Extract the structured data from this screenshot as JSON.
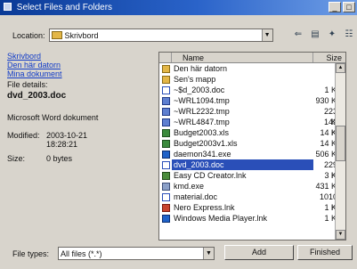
{
  "window": {
    "title": "Select Files and Folders"
  },
  "location": {
    "label": "Location:",
    "value": "Skrivbord"
  },
  "left": {
    "links": [
      "Skrivbord",
      "Den här datorn",
      "Mina dokument"
    ],
    "details_heading": "File details:",
    "file_name": "dvd_2003.doc",
    "file_type": "Microsoft Word dokument",
    "modified_label": "Modified:",
    "modified_value_line1": "2003-10-21",
    "modified_value_line2": "18:28:21",
    "size_label": "Size:",
    "size_value": "0 bytes"
  },
  "list": {
    "col_name": "Name",
    "col_size": "Size",
    "rows": [
      {
        "name": "Den här datorn",
        "size": "",
        "icon": "folder"
      },
      {
        "name": "Sen's mapp",
        "size": "",
        "icon": "folder"
      },
      {
        "name": "~$d_2003.doc",
        "size": "1 KB",
        "icon": "doc"
      },
      {
        "name": "~WRL1094.tmp",
        "size": "930 KB",
        "icon": "bmp"
      },
      {
        "name": "~WRL2232.tmp",
        "size": "2233 KB",
        "icon": "bmp"
      },
      {
        "name": "~WRL4847.tmp",
        "size": "1437 KB",
        "icon": "bmp"
      },
      {
        "name": "Budget2003.xls",
        "size": "14 KB",
        "icon": "xls"
      },
      {
        "name": "Budget2003v1.xls",
        "size": "14 KB",
        "icon": "xls"
      },
      {
        "name": "daemon341.exe",
        "size": "506 KB",
        "icon": "blue"
      },
      {
        "name": "dvd_2003.doc",
        "size": "2296 KB",
        "icon": "doc",
        "selected": true
      },
      {
        "name": "Easy CD Creator.lnk",
        "size": "3 KB",
        "icon": "lnk"
      },
      {
        "name": "kmd.exe",
        "size": "431 KB",
        "icon": "exe"
      },
      {
        "name": "material.doc",
        "size": "10103 KB",
        "icon": "doc"
      },
      {
        "name": "Nero Express.lnk",
        "size": "1 KB",
        "icon": "red"
      },
      {
        "name": "Windows Media Player.lnk",
        "size": "1 KB",
        "icon": "blue"
      }
    ]
  },
  "bottom": {
    "file_types_label": "File types:",
    "file_types_value": "All files (*.*)",
    "add_label": "Add",
    "finished_label": "Finished"
  },
  "colors": {
    "titlebar": "#0a3a96",
    "selection": "#2a4fb8",
    "folder": "#e3b646"
  }
}
